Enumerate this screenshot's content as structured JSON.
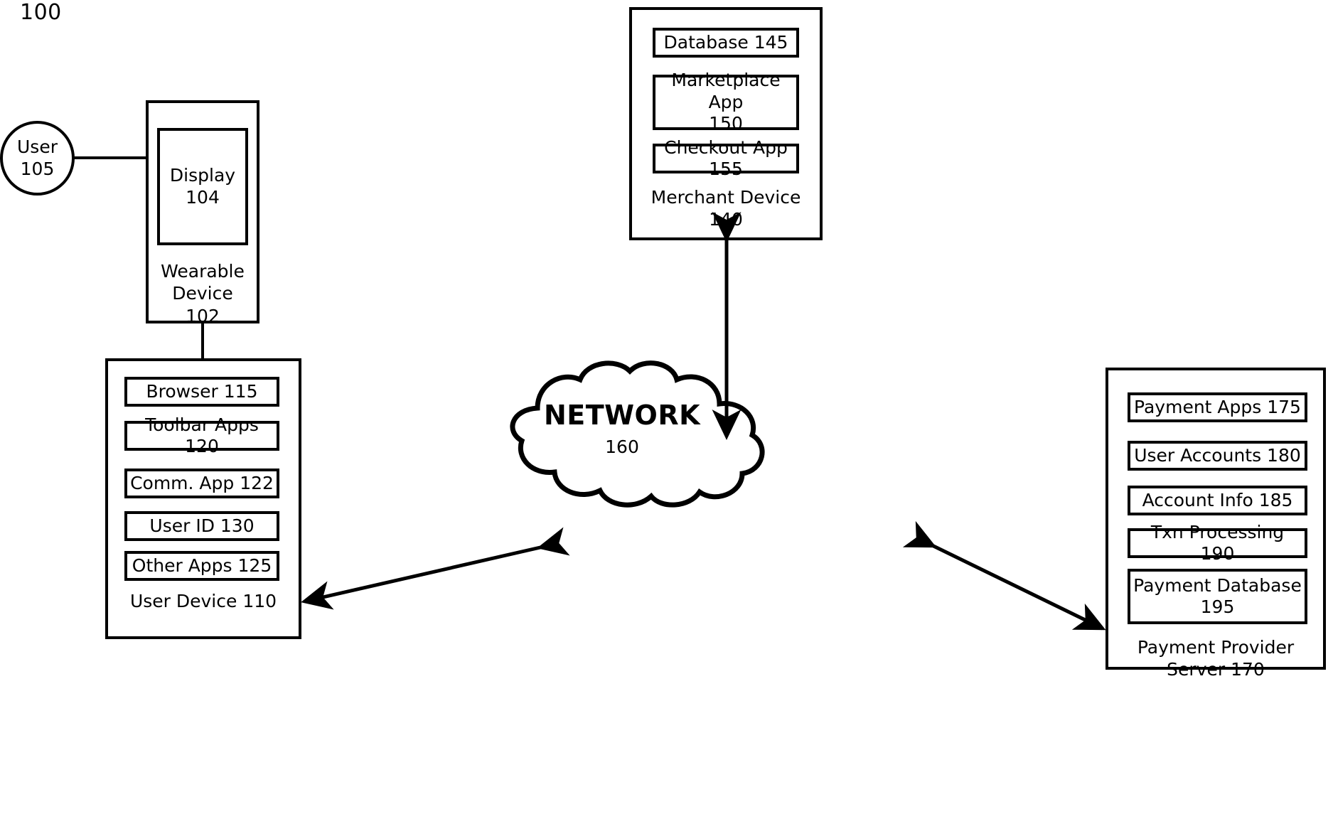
{
  "figure": {
    "number": "100"
  },
  "user": {
    "label": "User",
    "number": "105"
  },
  "wearable_device": {
    "caption": "Wearable\nDevice\n102",
    "display": {
      "label": "Display\n104"
    }
  },
  "user_device": {
    "caption": "User Device 110",
    "components": [
      {
        "label": "Browser 115"
      },
      {
        "label": "Toolbar Apps 120"
      },
      {
        "label": "Comm. App 122"
      },
      {
        "label": "User ID 130"
      },
      {
        "label": "Other Apps 125"
      }
    ]
  },
  "merchant_device": {
    "caption": "Merchant Device\n140",
    "components": [
      {
        "label": "Database 145"
      },
      {
        "label": "Marketplace App\n150"
      },
      {
        "label": "Checkout App 155"
      }
    ]
  },
  "payment_provider_server": {
    "caption": "Payment Provider\nServer 170",
    "components": [
      {
        "label": "Payment Apps 175"
      },
      {
        "label": "User Accounts 180"
      },
      {
        "label": "Account Info 185"
      },
      {
        "label": "Txn Processing 190"
      },
      {
        "label": "Payment Database\n195"
      }
    ]
  },
  "network": {
    "label": "NETWORK",
    "number": "160"
  },
  "colors": {
    "stroke": "#000000",
    "fill": "#ffffff"
  }
}
